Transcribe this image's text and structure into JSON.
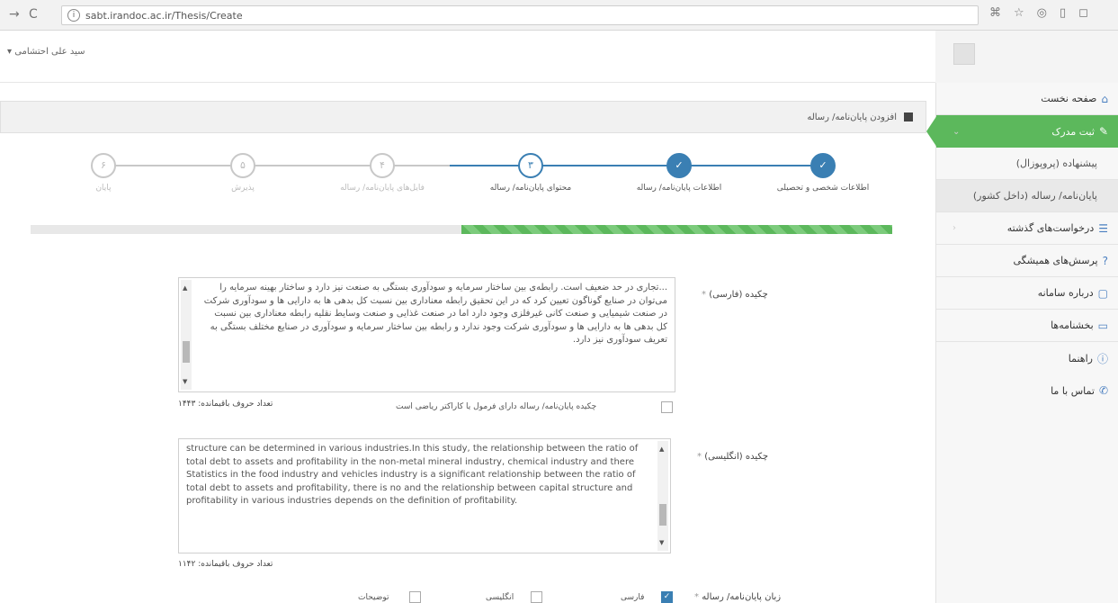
{
  "browser": {
    "url": "sabt.irandoc.ac.ir/Thesis/Create"
  },
  "topbar": {
    "user_name": "سید علی احتشامی"
  },
  "sidebar": {
    "items": [
      {
        "label": "صفحه نخست",
        "icon": "home-icon"
      },
      {
        "label": "ثبت مدرک",
        "icon": "document-edit-icon"
      },
      {
        "label": "پیشنهاده (پروپوزال)",
        "icon": ""
      },
      {
        "label": "پایان‌نامه/ رساله (داخل کشور)",
        "icon": ""
      },
      {
        "label": "درخواست‌های گذشته",
        "icon": "list-icon"
      },
      {
        "label": "پرسش‌های همیشگی",
        "icon": "question-icon"
      },
      {
        "label": "درباره سامانه",
        "icon": "file-icon"
      },
      {
        "label": "بخشنامه‌ها",
        "icon": "folder-icon"
      },
      {
        "label": "راهنما",
        "icon": "info-icon"
      },
      {
        "label": "تماس با ما",
        "icon": "phone-icon"
      }
    ]
  },
  "content": {
    "header_title": "افزودن پایان‌نامه/ رساله"
  },
  "stepper": {
    "steps": [
      {
        "label": "اطلاعات شخصی و تحصیلی",
        "marker": "✓",
        "state": "done"
      },
      {
        "label": "اطلاعات پایان‌نامه/ رساله",
        "marker": "✓",
        "state": "done"
      },
      {
        "label": "محتوای پایان‌نامه/ رساله",
        "marker": "۳",
        "state": "current"
      },
      {
        "label": "فایل‌های پایان‌نامه/ رساله",
        "marker": "۴",
        "state": "pending"
      },
      {
        "label": "پذیرش",
        "marker": "۵",
        "state": "pending"
      },
      {
        "label": "پایان",
        "marker": "۶",
        "state": "pending"
      }
    ],
    "progress_fraction": 0.5
  },
  "form": {
    "abstract_fa": {
      "label": "چکیده (فارسی)",
      "required_mark": "*",
      "text": "...تجاری در حد ضعیف است. رابطه‌ی بین ساختار سرمایه و سودآوری بستگی به صنعت نیز دارد و ساختار بهینه سرمایه را می‌توان در صنایع گوناگون تعیین کرد که در این تحقیق رابطه معناداری بین نسبت کل بدهی ها به دارایی ها و سودآوری شرکت در صنعت شیمیایی و صنعت کانی غیرفلزی وجود دارد اما در صنعت غذایی و صنعت وسایط نقلیه رابطه معناداری بین نسبت کل بدهی ها به دارایی ها و سودآوری شرکت وجود ندارد و رابطه بین ساختار سرمایه و سودآوری در صنایع مختلف بستگی به تعریف سودآوری نیز دارد.",
      "counter": "تعداد حروف باقیمانده: ۱۴۴۳",
      "checkbox_label": "چکیده پایان‌نامه/ رساله دارای فرمول یا کاراکتر ریاضی است"
    },
    "abstract_en": {
      "label": "چکیده (انگلیسی)",
      "required_mark": "*",
      "text": "structure can be determined in various industries.In this study, the relationship between the ratio of total debt to assets and profitability in the non-metal mineral industry, chemical industry and there Statistics in the food industry and vehicles industry is a significant relationship between the ratio of total debt to assets and profitability, there is no and the relationship between capital structure and profitability in various industries depends on the definition of profitability.",
      "counter": "تعداد حروف باقیمانده: ۱۱۴۲"
    },
    "language_row": {
      "label": "زبان پایان‌نامه/ رساله",
      "required_mark": "*",
      "options": [
        {
          "label": "فارسی",
          "checked": true
        },
        {
          "label": "انگلیسی",
          "checked": false
        },
        {
          "label": "توضیحات",
          "checked": false
        }
      ]
    }
  }
}
